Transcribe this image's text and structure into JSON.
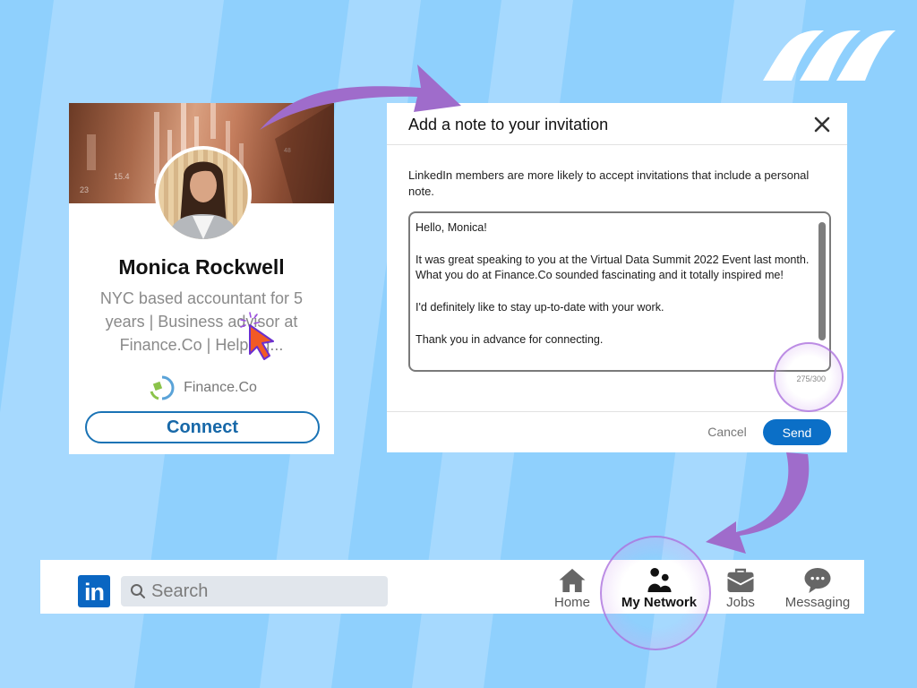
{
  "colors": {
    "background": "#8fd0fd",
    "stripe_light": "#a6d9fe",
    "accent_purple": "#9f6ccb",
    "linkedin_blue": "#0a66c2",
    "send_button": "#0b6fc7",
    "cursor_orange": "#f25a25"
  },
  "profile_card": {
    "name": "Monica Rockwell",
    "headline": "NYC based accountant for 5 years | Business advisor at Finance.Co | Helping...",
    "company": "Finance.Co",
    "connect_label": "Connect"
  },
  "modal": {
    "title": "Add a note to your invitation",
    "close_icon": "close-icon",
    "description": "LinkedIn members are more likely to accept invitations that include a personal note.",
    "note_value": "Hello, Monica!\n\nIt was great speaking to you at the Virtual Data Summit 2022 Event last month. What you do at Finance.Co sounded fascinating and it totally inspired me!\n\nI'd definitely like to stay up-to-date with your work.\n\nThank you in advance for connecting.",
    "char_count": "275/300",
    "cancel_label": "Cancel",
    "send_label": "Send"
  },
  "navbar": {
    "logo_text": "in",
    "search_placeholder": "Search",
    "items": [
      {
        "label": "Home",
        "icon": "home-icon",
        "active": false
      },
      {
        "label": "My Network",
        "icon": "network-icon",
        "active": true
      },
      {
        "label": "Jobs",
        "icon": "briefcase-icon",
        "active": false
      },
      {
        "label": "Messaging",
        "icon": "chat-icon",
        "active": false
      }
    ]
  }
}
